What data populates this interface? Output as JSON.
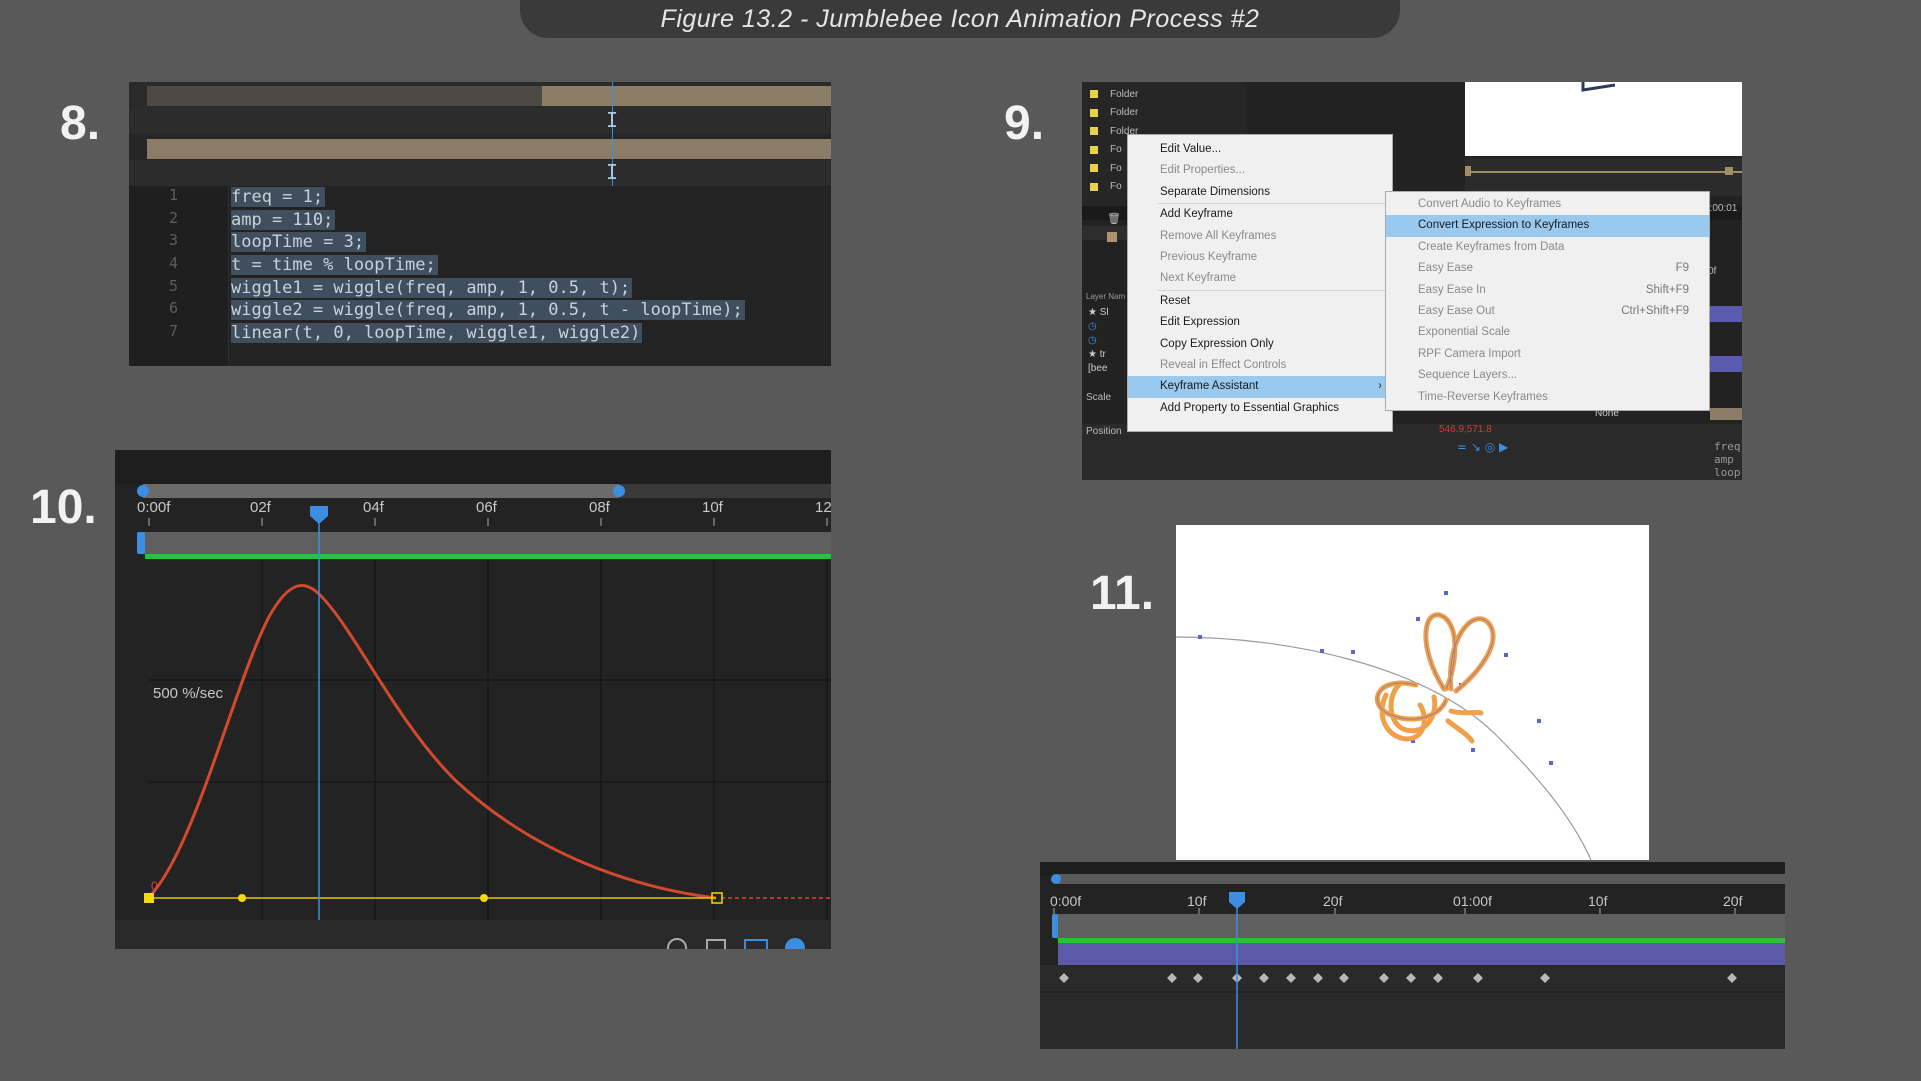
{
  "figure_title": "Figure 13.2 - Jumblebee Icon Animation Process #2",
  "steps": {
    "s8": "8.",
    "s9": "9.",
    "s10": "10.",
    "s11": "11."
  },
  "code_editor": {
    "line_numbers": [
      "1",
      "2",
      "3",
      "4",
      "5",
      "6",
      "7"
    ],
    "lines": [
      "freq = 1;",
      "amp = 110;",
      "loopTime = 3;",
      "t = time % loopTime;",
      "wiggle1 = wiggle(freq, amp, 1, 0.5, t);",
      "wiggle2 = wiggle(freq, amp, 1, 0.5, t - loopTime);",
      "linear(t, 0, loopTime, wiggle1, wiggle2)"
    ]
  },
  "ae_context": {
    "project_items": [
      "Folder",
      "Folder",
      "Folder",
      "Fo",
      "Fo",
      "Fo"
    ],
    "layer_name_header": "Layer Nam",
    "layer_names": [
      "Sl",
      "tr",
      "[bee"
    ],
    "property_scale": "Scale",
    "property_position": "Position",
    "position_value": "546.9,571.8",
    "parent_value": "None",
    "timecode": "0:00:01",
    "timecode_small": "0f",
    "code_peek": [
      "freq",
      "amp",
      "loop"
    ]
  },
  "context_menu": {
    "items": [
      {
        "label": "Edit Value...",
        "enabled": true
      },
      {
        "label": "Edit Properties...",
        "enabled": false
      },
      {
        "label": "Separate Dimensions",
        "enabled": true
      },
      {
        "sep": true
      },
      {
        "label": "Add Keyframe",
        "enabled": true
      },
      {
        "label": "Remove All Keyframes",
        "enabled": false
      },
      {
        "label": "Previous Keyframe",
        "enabled": false
      },
      {
        "label": "Next Keyframe",
        "enabled": false
      },
      {
        "sep": true
      },
      {
        "label": "Reset",
        "enabled": true
      },
      {
        "label": "Edit Expression",
        "enabled": true
      },
      {
        "label": "Copy Expression Only",
        "enabled": true
      },
      {
        "label": "Reveal in Effect Controls",
        "enabled": false
      },
      {
        "label": "Keyframe Assistant",
        "enabled": true,
        "selected": true,
        "submenu": true
      },
      {
        "label": "Add Property to Essential Graphics",
        "enabled": true
      }
    ],
    "submenu_items": [
      {
        "label": "Convert Audio to Keyframes",
        "enabled": false,
        "shortcut": ""
      },
      {
        "label": "Convert Expression to Keyframes",
        "enabled": true,
        "selected": true,
        "shortcut": ""
      },
      {
        "label": "Create Keyframes from Data",
        "enabled": false,
        "shortcut": ""
      },
      {
        "label": "Easy Ease",
        "enabled": false,
        "shortcut": "F9"
      },
      {
        "label": "Easy Ease In",
        "enabled": false,
        "shortcut": "Shift+F9"
      },
      {
        "label": "Easy Ease Out",
        "enabled": false,
        "shortcut": "Ctrl+Shift+F9"
      },
      {
        "label": "Exponential Scale",
        "enabled": false,
        "shortcut": ""
      },
      {
        "label": "RPF Camera Import",
        "enabled": false,
        "shortcut": ""
      },
      {
        "label": "Sequence Layers...",
        "enabled": false,
        "shortcut": ""
      },
      {
        "label": "Time-Reverse Keyframes",
        "enabled": false,
        "shortcut": ""
      }
    ]
  },
  "graph_editor": {
    "ruler_labels": [
      "0:00f",
      "02f",
      "04f",
      "06f",
      "08f",
      "10f",
      "12"
    ],
    "velocity_label": "500 %/sec",
    "baseline_label": "0"
  },
  "timeline_11": {
    "ruler_labels": [
      "0:00f",
      "10f",
      "20f",
      "01:00f",
      "10f",
      "20f"
    ]
  },
  "colors": {
    "background": "#595959",
    "curve": "#d24a2e",
    "playhead": "#3b8ee0",
    "keyframe_yellow": "#f5d90a",
    "work_area_green": "#2fbf3b",
    "menu_highlight": "#99c9ef",
    "bee_orange": "#f0a048"
  }
}
